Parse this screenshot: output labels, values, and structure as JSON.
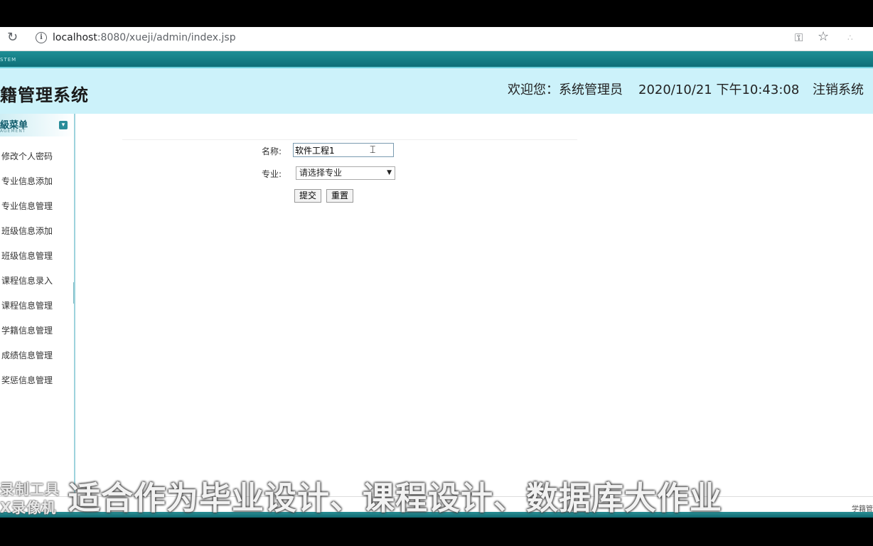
{
  "browser": {
    "url_host": "localhost",
    "url_rest": ":8080/xueji/admin/index.jsp"
  },
  "header": {
    "system_tag": "STEM",
    "title": "籍管理系统",
    "welcome": "欢迎您：系统管理员",
    "datetime": "2020/10/21 下午10:43:08",
    "logout": "注销系统"
  },
  "sidebar": {
    "title": "級菜单",
    "subtitle": "AGEMENT",
    "items": [
      "修改个人密码",
      "专业信息添加",
      "专业信息管理",
      "班级信息添加",
      "班级信息管理",
      "课程信息录入",
      "课程信息管理",
      "学籍信息管理",
      "成绩信息管理",
      "奖惩信息管理"
    ]
  },
  "form": {
    "name_label": "名称:",
    "name_value": "软件工程1",
    "major_label": "专业:",
    "major_selected": "请选择专业",
    "submit_label": "提交",
    "reset_label": "重置"
  },
  "footer": {
    "text": "学籍管"
  },
  "overlay": {
    "watermark_line1": "录制工具",
    "watermark_line2": "X录像机",
    "subtitle": "适合作为毕业设计、课程设计、数据库大作业"
  },
  "colors": {
    "header_bg": "#ccf2fa",
    "strip": "#0f6f78"
  }
}
